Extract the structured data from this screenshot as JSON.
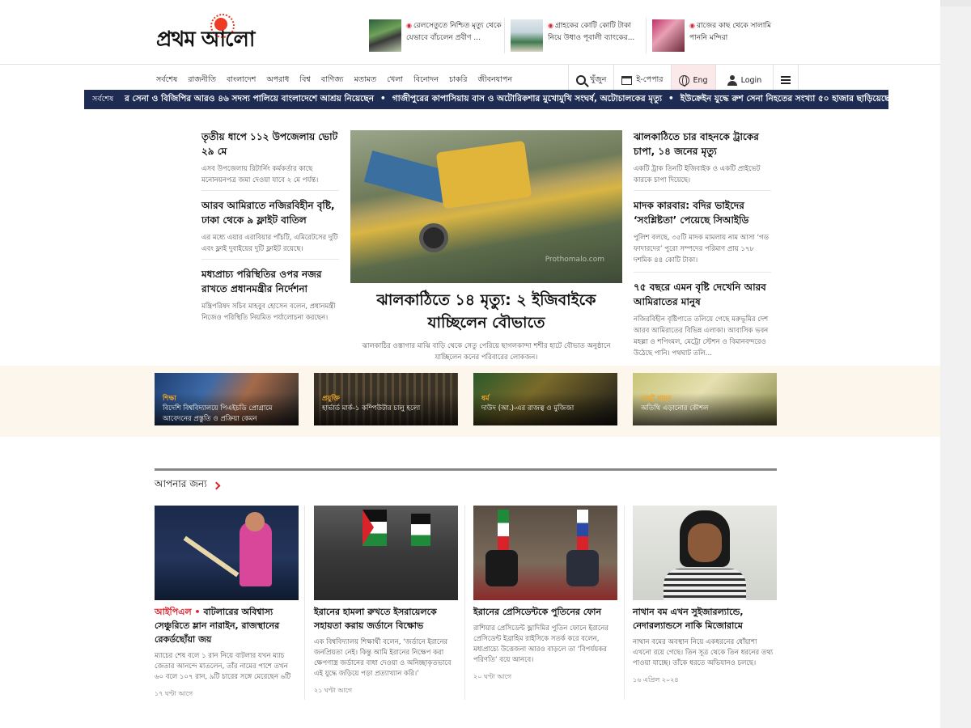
{
  "brand": {
    "logo_text": "প্রথম আলো"
  },
  "header_headlines": [
    {
      "text": "রেলসেতুতে নিশ্চিত মৃত্যু থেকে যেভাবে বাঁচলেন প্রবীণ ..."
    },
    {
      "text": "গ্রাহকের কোটি কোটি টাকা নিয়ে উধাও পূবালী ব্যাংকের..."
    },
    {
      "text": "রাজের কাছ থেকে সালামি পাননি মন্দিরা"
    }
  ],
  "nav": {
    "items": [
      "সর্বশেষ",
      "রাজনীতি",
      "বাংলাদেশ",
      "অপরাধ",
      "বিশ্ব",
      "বাণিজ্য",
      "মতামত",
      "খেলা",
      "বিনোদন",
      "চাকরি",
      "জীবনযাপন"
    ],
    "search_label": "খুঁজুন",
    "epaper_label": "ই-পেপার",
    "lang_label": "Eng",
    "login_label": "Login"
  },
  "ticker": {
    "label": "সর্বশেষ",
    "items": [
      "র সেনা ও বিজিপির আরও ৪৬ সদস্য পালিয়ে বাংলাদেশে আশ্রয় নিয়েছেন",
      "গাজীপুরের কাপাসিয়ায় বাস ও অটোরিকশার মুখোমুখি সংঘর্ষ, অটোচালকের মৃত্যু",
      "ইউক্রেইন যুদ্ধে রুশ সেনা নিহতের সংখ্যা ৫০ হাজার ছাড়িয়েছে: বিবিসি"
    ]
  },
  "left_stories": [
    {
      "title": "তৃতীয় ধাপে ১১২ উপজেলায় ভোট ২৯ মে",
      "desc": "এসব উপজেলায় রিটার্নিং কর্মকর্তার কাছে মনোনয়নপত্র জমা দেওয়া যাবে ২ মে পর্যন্ত।"
    },
    {
      "title": "আরব আমিরাতে নজিরবিহীন বৃষ্টি, ঢাকা থেকে ৯ ফ্লাইট বাতিল",
      "desc": "এর মধ্যে এয়ার এরাবিয়ার পাঁচটি, এমিরেটসের দুটি এবং ফ্লাই দুবাইয়ের দুটি ফ্লাইট রয়েছে।"
    },
    {
      "title": "মধ্যপ্রাচ্য পরিস্থিতির ওপর নজর রাখতে প্রধানমন্ত্রীর নির্দেশনা",
      "desc": "মন্ত্রিপরিষদ সচিব মাহবুব হোসেন বলেন, প্রধানমন্ত্রী নিজেও পরিস্থিতি নিয়মিত পর্যালোচনা করছেন।"
    }
  ],
  "lead": {
    "title": "ঝালকাঠিতে ১৪ মৃত্যু: ২ ইজিবাইকে যাচ্ছিলেন বৌভাতে",
    "desc": "ঝালকাঠির ওস্তাগার মাঝি বাড়ি থেকে সেতু পেরিয়ে ছাগলকান্দা শশীর হাটে বৌভাত অনুষ্ঠানে যাচ্ছিলেন কনের পরিবারের লোকজন।",
    "watermark": "Prothomalo.com"
  },
  "right_stories": [
    {
      "title": "ঝালকাঠিতে চার বাহনকে ট্রাকের চাপা, ১৪ জনের মৃত্যু",
      "desc": "একটি ট্রাক তিনটি ইজিবাইক ও একটি প্রাইভেট কারকে চাপা দিয়েছে।"
    },
    {
      "title": "মাদক কারবার: বদির ভাইদের ‘সংশ্লিষ্টতা’ পেয়েছে সিআইডি",
      "desc": "পুলিশ বলছে, ৩৫টি মাদক মামলায় নাম আসা ‘গড ফাদারদের’ পুরো সম্পদের পরিমাণ প্রায় ১৭৮ দশমিক ৪৪ কোটি টাকা।"
    },
    {
      "title": "৭৫ বছরে এমন বৃষ্টি দেখেনি আরব আমিরাতের মানুষ",
      "desc": "নজিরবিহীন বৃষ্টিপাতে তলিয়ে গেছে মরুভূমির দেশ আরব আমিরাতের বিভিন্ন এলাকা। আবাসিক ভবন মহল্লা ও শপিংমল, মেট্রো স্টেশন ও বিমানবন্দরেও উঠেছে পানি। পথঘাট তলি..."
    }
  ],
  "features": [
    {
      "category": "শিক্ষা",
      "title": "বিদেশি বিশ্ববিদ্যালয়ে পিএইচডি প্রোগ্রামে আবেদনের প্রস্তুতি ও প্রক্রিয়া কেমন"
    },
    {
      "category": "প্রযুক্তি",
      "title": "হার্ভার্ড মার্ক-১ কম্পিউটার চালু হলো"
    },
    {
      "category": "ধর্ম",
      "title": "দাউদ (আ.)-এর রাজত্ব ও মুজিজা"
    },
    {
      "category": "একটু থামুন",
      "title": "অতিথি এড়ানোর কৌশল"
    }
  ],
  "for_you": {
    "title": "আপনার জন্য",
    "cards": [
      {
        "kicker": "আইপিএল •",
        "title": "বাটলারের অবিশ্বাস্য সেঞ্চুরিতে ম্লান নারাইন, রাজস্থানের রেকর্ডছোঁয়া জয়",
        "desc": "ম্যাচের শেষ বলে ১ রান নিয়ে বাটলার যখন ম্যাচ জেতার আনন্দে মাতলেন, তাঁর নামের পাশে তখন ৬০ বলে ১০৭ রান, ৯টি চারের সঙ্গে মেরেছেন ৬টি",
        "time": "১৭ ঘণ্টা আগে"
      },
      {
        "kicker": "",
        "title": "ইরানের হামলা রুখতে ইসরায়েলকে সহায়তা করায় জর্ডানে বিক্ষোভ",
        "desc": "এক বিশ্ববিদ্যালয় শিক্ষার্থী বলেন, ‘জর্ডানে ইরানের জনপ্রিয়তা নেই। কিন্তু আমি ইরানের নিক্ষেপ করা ক্ষেপণাস্ত্র জর্ডানের বাধা দেওয়া ও অনিচ্ছাকৃতভাবে এই যুদ্ধে জড়িয়ে পড়া প্রত্যাখ্যান করি।’",
        "time": "২১ ঘণ্টা আগে"
      },
      {
        "kicker": "",
        "title": "ইরানের প্রেসিডেন্টকে পুতিনের ফোন",
        "desc": "রাশিয়ার প্রেসিডেন্ট ভ্লাদিমির পুতিন ফোনে ইরানের প্রেসিডেন্ট ইব্রাহিম রাইসিকে সতর্ক করে বলেন, মধ্যপ্রাচ্যে উত্তেজনা আরও বাড়লে তা ‘বিপর্যয়কর পরিণতি’ বয়ে আনবে।",
        "time": "২০ ঘণ্টা আগে"
      },
      {
        "kicker": "",
        "title": "নাথান বম এখন সুইজারল্যান্ডে, নেদারল্যান্ডসে নাকি মিজোরামে",
        "desc": "নাথান বমের অবস্থান নিয়ে একধরনের ধোঁয়াশা এখনো রয়ে গেছে। তিন সূত্র থেকে তিন ধরনের তথ্য পাওয়া যাচ্ছে। তাঁকে ধরতে অভিযানও চলছে।",
        "time": "১৬ এপ্রিল ২০২৪"
      }
    ]
  },
  "icons": [
    "search-icon",
    "epaper-icon",
    "globe-icon",
    "user-icon",
    "menu-icon",
    "chevron-right-icon"
  ],
  "colors": {
    "accent": "#d8232a",
    "ticker_bg": "#1e2c53",
    "band_bg": "#fcf6ec",
    "feature_category": "#f5a623"
  }
}
